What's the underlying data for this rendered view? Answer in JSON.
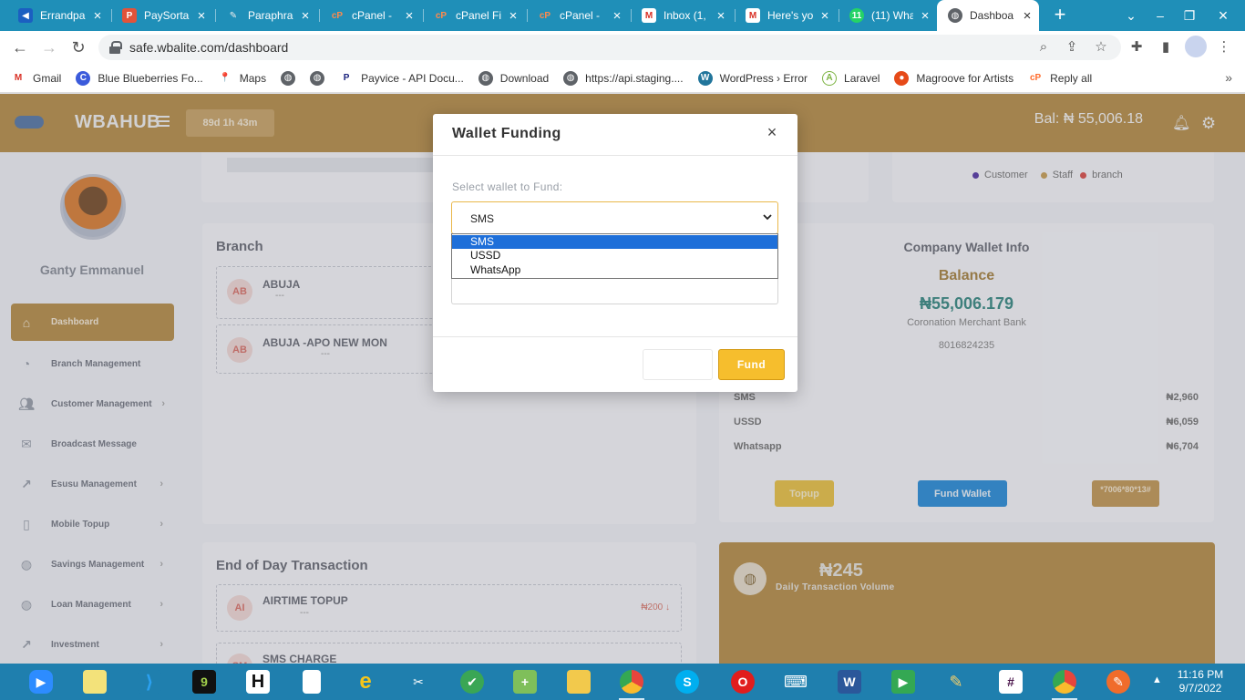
{
  "browser": {
    "tabs": [
      {
        "title": "Errandpa",
        "icon_color": "#1b5fc1",
        "icon": "errandpay-icon"
      },
      {
        "title": "PaySorta",
        "icon_color": "#e2533a",
        "icon": "paysorta-icon"
      },
      {
        "title": "Paraphra",
        "icon_color": "#6b6b6b",
        "icon": "quill-icon"
      },
      {
        "title": "cPanel - ",
        "icon_color": "#ff6c2c",
        "icon": "cpanel-icon"
      },
      {
        "title": "cPanel Fil",
        "icon_color": "#ff6c2c",
        "icon": "cpanel-icon"
      },
      {
        "title": "cPanel - ",
        "icon_color": "#ff6c2c",
        "icon": "cpanel-icon"
      },
      {
        "title": "Inbox (1,",
        "icon_color": "#d93025",
        "icon": "gmail-icon"
      },
      {
        "title": "Here's yo",
        "icon_color": "#d93025",
        "icon": "gmail-icon"
      },
      {
        "title": "(11) Wha",
        "icon_color": "#25d366",
        "icon": "whatsapp-icon"
      },
      {
        "title": "Dashboa",
        "icon_color": "#5f6368",
        "icon": "globe-icon",
        "active": true
      }
    ],
    "new_tab": "+",
    "url": "safe.wbalite.com/dashboard",
    "bookmarks": [
      {
        "label": "Gmail",
        "icon_color": "#d93025",
        "icon": "gmail-icon"
      },
      {
        "label": "Blue Blueberries Fo...",
        "icon_color": "#3b5bdb",
        "icon": "blueberries-icon"
      },
      {
        "label": "Maps",
        "icon_color": "#34a853",
        "icon": "maps-icon"
      },
      {
        "label": "",
        "icon_color": "#5f6368",
        "icon": "globe-icon"
      },
      {
        "label": "",
        "icon_color": "#5f6368",
        "icon": "globe-icon"
      },
      {
        "label": "Payvice - API Docu...",
        "icon_color": "#1a237e",
        "icon": "payvice-icon"
      },
      {
        "label": "Download",
        "icon_color": "#5f6368",
        "icon": "globe-icon"
      },
      {
        "label": "https://api.staging....",
        "icon_color": "#5f6368",
        "icon": "globe-icon"
      },
      {
        "label": "WordPress › Error",
        "icon_color": "#21759b",
        "icon": "wordpress-icon"
      },
      {
        "label": "Laravel",
        "icon_color": "#7cb342",
        "icon": "laravel-icon"
      },
      {
        "label": "Magroove for Artists",
        "icon_color": "#e64a19",
        "icon": "magroove-icon"
      },
      {
        "label": "Reply all",
        "icon_color": "#ff6c2c",
        "icon": "cpanel-icon"
      }
    ],
    "bookmarks_more": "»"
  },
  "app": {
    "brand": "WBAHUB",
    "timer": "89d 1h 43m",
    "balance": "Bal: ₦ 55,006.18",
    "user_name": "Ganty Emmanuel",
    "menu": [
      {
        "label": "Dashboard",
        "icon": "home-icon",
        "active": true,
        "chevron": false
      },
      {
        "label": "Branch Management",
        "icon": "pie-chart-icon",
        "chevron": false
      },
      {
        "label": "Customer Management",
        "icon": "users-icon",
        "chevron": true
      },
      {
        "label": "Broadcast Message",
        "icon": "mail-icon",
        "chevron": false
      },
      {
        "label": "Esusu Management",
        "icon": "trend-icon",
        "chevron": true
      },
      {
        "label": "Mobile Topup",
        "icon": "phone-icon",
        "chevron": true
      },
      {
        "label": "Savings Management",
        "icon": "globe-icon",
        "chevron": true
      },
      {
        "label": "Loan Management",
        "icon": "globe-icon",
        "chevron": true
      },
      {
        "label": "Investment",
        "icon": "trend-icon",
        "chevron": true
      }
    ],
    "legend": [
      {
        "label": "Customer",
        "color": "#5a3ea8"
      },
      {
        "label": "Staff",
        "color": "#c9a15b"
      },
      {
        "label": "branch",
        "color": "#d9534f"
      }
    ],
    "branch": {
      "title": "Branch",
      "items": [
        {
          "badge": "AB",
          "name": "ABUJA",
          "sub": "---"
        },
        {
          "badge": "AB",
          "name": "ABUJA -APO NEW MON",
          "sub": "---"
        }
      ]
    },
    "wallet": {
      "title": "Company Wallet Info",
      "balance_label": "Balance",
      "balance": "₦55,006.179",
      "bank": "Coronation Merchant Bank",
      "account": "8016824235",
      "rows": [
        {
          "label": "SMS",
          "value": "₦2,960"
        },
        {
          "label": "USSD",
          "value": "₦6,059"
        },
        {
          "label": "Whatsapp",
          "value": "₦6,704"
        }
      ],
      "topup_label": "Topup",
      "fund_label": "Fund Wallet",
      "ussd_code": "*7006*80*13#"
    },
    "eod": {
      "title": "End of Day Transaction",
      "items": [
        {
          "badge": "AI",
          "name": "AIRTIME TOPUP",
          "sub": "---",
          "amount": "₦200 ↓"
        },
        {
          "badge": "SM",
          "name": "SMS CHARGE",
          "sub": "",
          "amount": ""
        }
      ]
    },
    "daily": {
      "amount": "₦245",
      "label": "Daily Transaction Volume"
    }
  },
  "modal": {
    "title": "Wallet Funding",
    "close": "×",
    "select_label": "Select wallet to Fund:",
    "selected": "SMS",
    "options": [
      "SMS",
      "USSD",
      "WhatsApp"
    ],
    "close_button": "",
    "fund_button": "Fund"
  },
  "taskbar": {
    "time": "11:16 PM",
    "date": "9/7/2022",
    "apps": [
      {
        "name": "zoom-icon",
        "color": "#2d8cff",
        "glyph": "▶"
      },
      {
        "name": "sticky-notes-icon",
        "color": "#f3e27a",
        "glyph": ""
      },
      {
        "name": "vscode-icon",
        "color": "#1f7fae",
        "glyph": "⟩"
      },
      {
        "name": "nine-mobile-icon",
        "color": "#111111",
        "glyph": "9"
      },
      {
        "name": "h-app-icon",
        "color": "#111111",
        "glyph": "H"
      },
      {
        "name": "file-icon",
        "color": "#ffffff",
        "glyph": ""
      },
      {
        "name": "ie-icon",
        "color": "#1f7fae",
        "glyph": "e"
      },
      {
        "name": "snipping-icon",
        "color": "#1f7fae",
        "glyph": "✂"
      },
      {
        "name": "green-app-icon",
        "color": "#3aa655",
        "glyph": "✔"
      },
      {
        "name": "notepad-plus-icon",
        "color": "#7fbf5a",
        "glyph": "+"
      },
      {
        "name": "file-explorer-icon",
        "color": "#f2c94c",
        "glyph": ""
      },
      {
        "name": "chrome-icon",
        "color": "#e8453c",
        "glyph": "",
        "open": true
      },
      {
        "name": "skype-icon",
        "color": "#00aff0",
        "glyph": "S"
      },
      {
        "name": "opera-icon",
        "color": "#e11d1d",
        "glyph": "O"
      },
      {
        "name": "keyboard-icon",
        "color": "#1f7fae",
        "glyph": "⌨"
      },
      {
        "name": "word-icon",
        "color": "#2b579a",
        "glyph": "W"
      },
      {
        "name": "meet-icon",
        "color": "#34a853",
        "glyph": "▶"
      },
      {
        "name": "paint-icon",
        "color": "#1f7fae",
        "glyph": "🎨"
      },
      {
        "name": "slack-icon",
        "color": "#ffffff",
        "glyph": "#"
      },
      {
        "name": "chrome-profile-icon",
        "color": "#e8453c",
        "glyph": "",
        "open": true
      },
      {
        "name": "pen-app-icon",
        "color": "#f06c2b",
        "glyph": "✎"
      }
    ]
  }
}
